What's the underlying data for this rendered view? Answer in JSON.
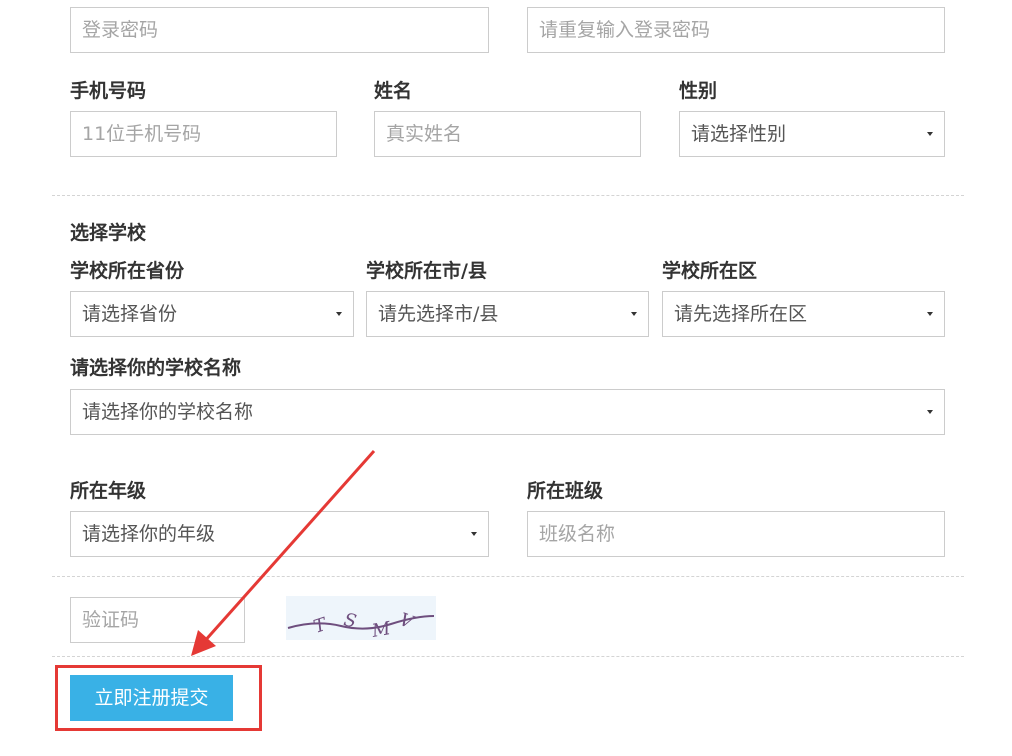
{
  "account": {
    "password_placeholder": "登录密码",
    "confirm_password_placeholder": "请重复输入登录密码"
  },
  "personal": {
    "phone_label": "手机号码",
    "phone_placeholder": "11位手机号码",
    "name_label": "姓名",
    "name_placeholder": "真实姓名",
    "gender_label": "性别",
    "gender_value": "请选择性别"
  },
  "school": {
    "section_title": "选择学校",
    "province_label": "学校所在省份",
    "province_value": "请选择省份",
    "city_label": "学校所在市/县",
    "city_value": "请先选择市/县",
    "district_label": "学校所在区",
    "district_value": "请先选择所在区",
    "school_name_label": "请选择你的学校名称",
    "school_name_value": "请选择你的学校名称"
  },
  "grade": {
    "grade_label": "所在年级",
    "grade_value": "请选择你的年级",
    "class_label": "所在班级",
    "class_placeholder": "班级名称"
  },
  "captcha": {
    "placeholder": "验证码",
    "image_text": "TSMV"
  },
  "submit": {
    "label": "立即注册提交"
  },
  "annotation": {
    "color": "#e53935"
  },
  "colors": {
    "accent": "#39b1e6",
    "border": "#cccccc",
    "placeholder": "#a5a5a5"
  }
}
